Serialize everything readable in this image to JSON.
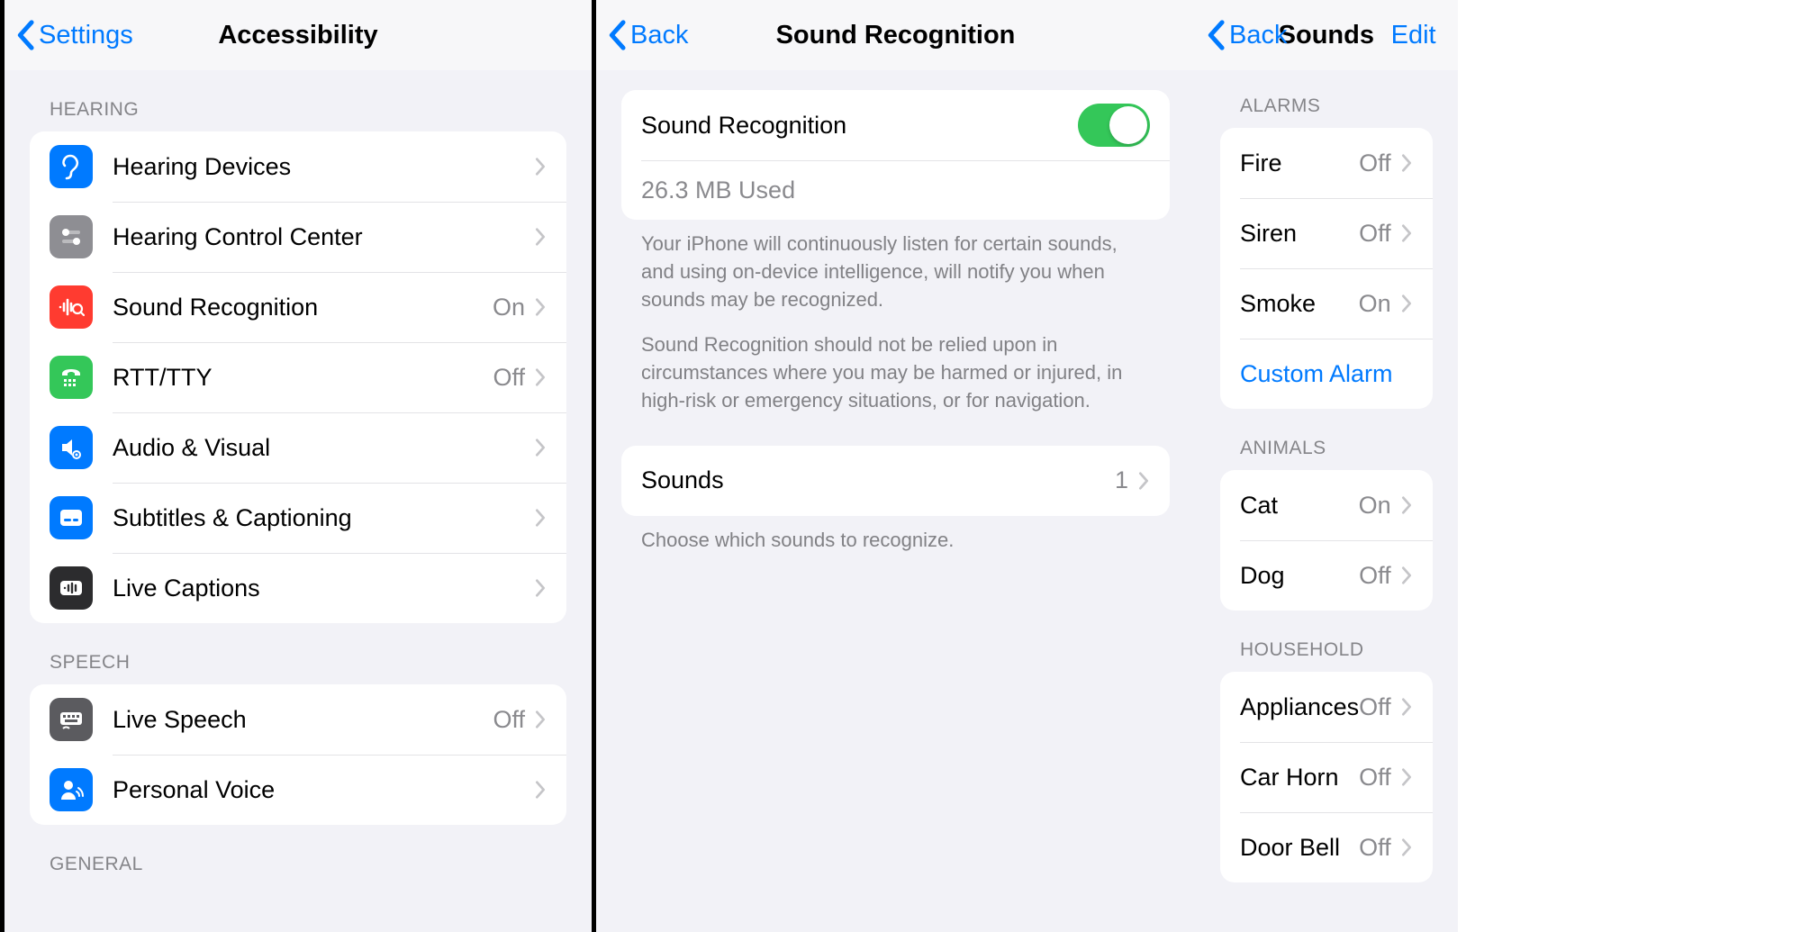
{
  "pane1": {
    "back_label": "Settings",
    "title": "Accessibility",
    "sections": {
      "hearing": {
        "header": "HEARING",
        "items": [
          {
            "label": "Hearing Devices"
          },
          {
            "label": "Hearing Control Center"
          },
          {
            "label": "Sound Recognition",
            "value": "On"
          },
          {
            "label": "RTT/TTY",
            "value": "Off"
          },
          {
            "label": "Audio & Visual"
          },
          {
            "label": "Subtitles & Captioning"
          },
          {
            "label": "Live Captions"
          }
        ]
      },
      "speech": {
        "header": "SPEECH",
        "items": [
          {
            "label": "Live Speech",
            "value": "Off"
          },
          {
            "label": "Personal Voice"
          }
        ]
      },
      "general": {
        "header": "GENERAL"
      }
    }
  },
  "pane2": {
    "back_label": "Back",
    "title": "Sound Recognition",
    "toggle_label": "Sound Recognition",
    "storage_line": "26.3 MB Used",
    "desc1": "Your iPhone will continuously listen for certain sounds, and using on-device intelligence, will notify you when sounds may be recognized.",
    "desc2": "Sound Recognition should not be relied upon in circumstances where you may be harmed or injured, in high-risk or emergency situations, or for navigation.",
    "sounds_label": "Sounds",
    "sounds_value": "1",
    "sounds_hint": "Choose which sounds to recognize."
  },
  "pane3": {
    "back_label": "Back",
    "title": "Sounds",
    "action": "Edit",
    "sections": {
      "alarms": {
        "header": "ALARMS",
        "items": [
          {
            "label": "Fire",
            "value": "Off"
          },
          {
            "label": "Siren",
            "value": "Off"
          },
          {
            "label": "Smoke",
            "value": "On"
          }
        ],
        "custom": "Custom Alarm"
      },
      "animals": {
        "header": "ANIMALS",
        "items": [
          {
            "label": "Cat",
            "value": "On"
          },
          {
            "label": "Dog",
            "value": "Off"
          }
        ]
      },
      "household": {
        "header": "HOUSEHOLD",
        "items": [
          {
            "label": "Appliances",
            "value": "Off"
          },
          {
            "label": "Car Horn",
            "value": "Off"
          },
          {
            "label": "Door Bell",
            "value": "Off"
          }
        ]
      }
    }
  }
}
